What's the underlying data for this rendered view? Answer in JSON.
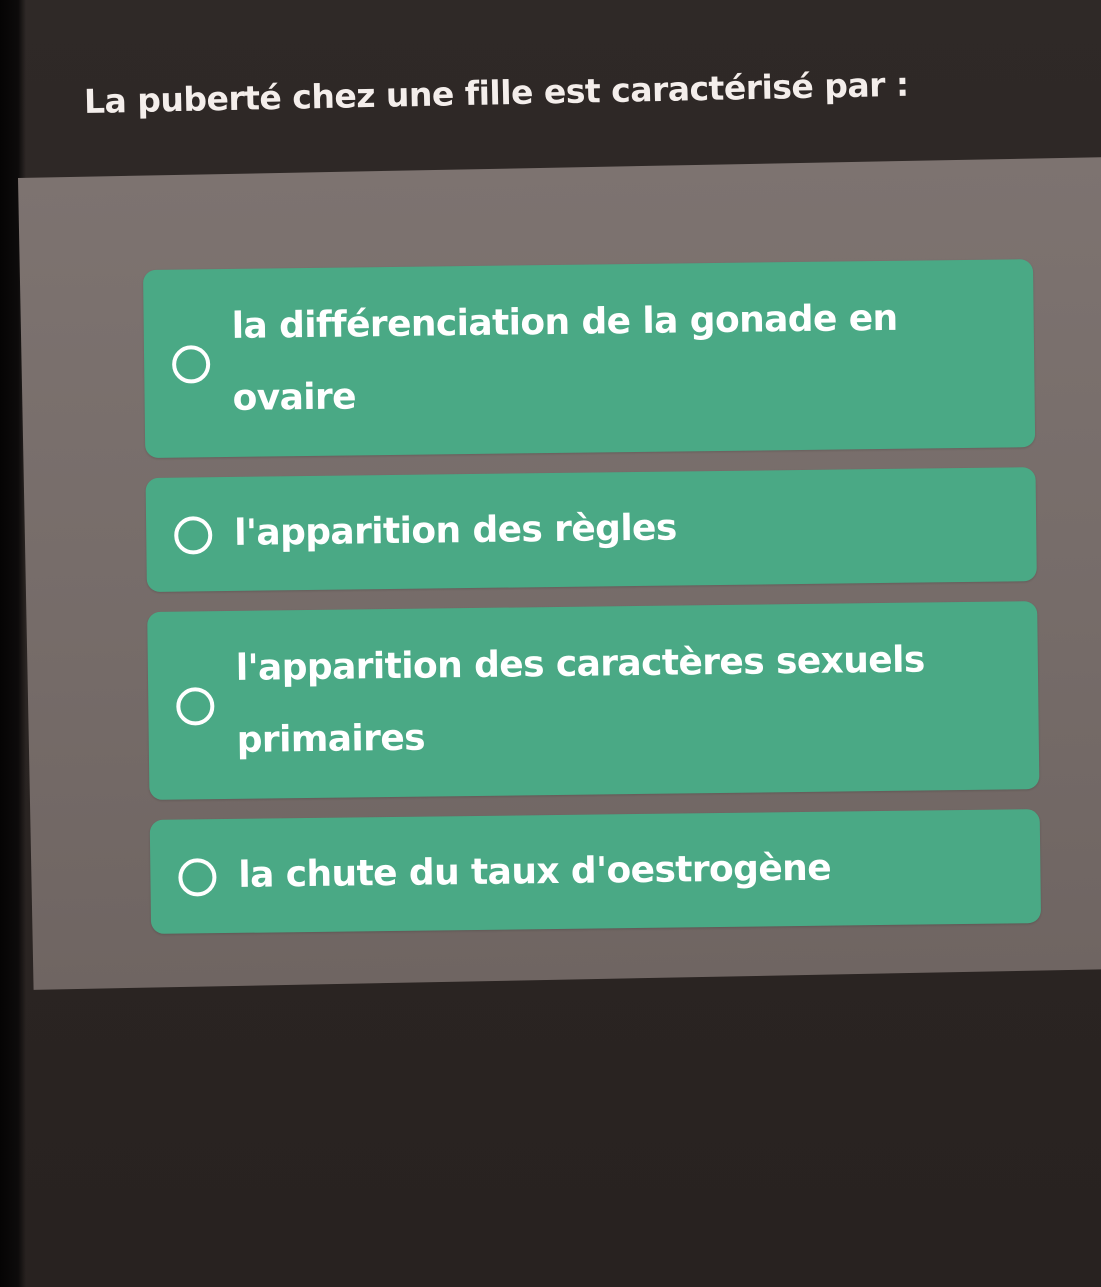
{
  "question": {
    "text": "La puberté chez une fille est caractérisé par :"
  },
  "options": [
    {
      "label": "la différenciation de la gonade en ovaire",
      "selected": false
    },
    {
      "label": "l'apparition des règles",
      "selected": false
    },
    {
      "label": "l'apparition des caractères sexuels primaires",
      "selected": false
    },
    {
      "label": "la chute du taux d'oestrogène",
      "selected": false
    }
  ],
  "colors": {
    "background": "#2c2624",
    "panel": "#766c69",
    "option": "#4aa985",
    "text": "#ffffff"
  },
  "icons": {
    "radio": "radio-unchecked-icon"
  }
}
